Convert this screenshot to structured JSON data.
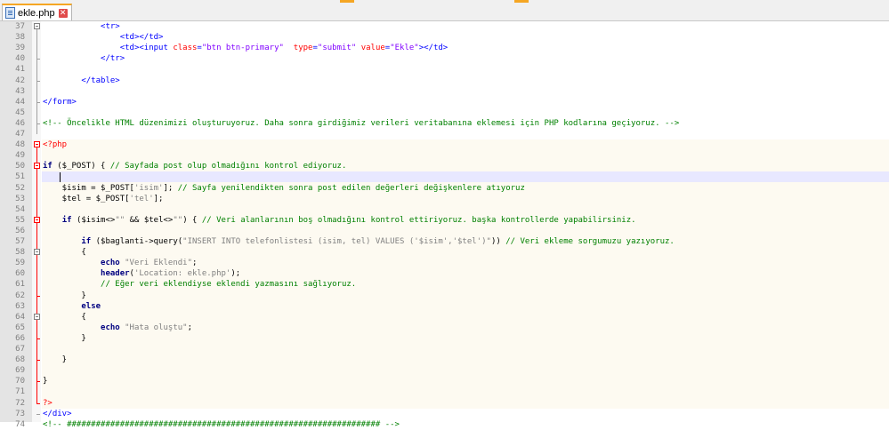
{
  "tab": {
    "label": "ekle.php",
    "close": "✕",
    "file_icon": "php-file-icon"
  },
  "lines": [
    {
      "n": "37",
      "segs": [
        {
          "c": "tg",
          "t": "            <tr>"
        }
      ]
    },
    {
      "n": "38",
      "segs": [
        {
          "c": "tg",
          "t": "                <td></td>"
        }
      ]
    },
    {
      "n": "39",
      "segs": [
        {
          "c": "tg",
          "t": "                <td><input "
        },
        {
          "c": "at",
          "t": "class"
        },
        {
          "c": "tg",
          "t": "="
        },
        {
          "c": "va",
          "t": "\"btn btn-primary\""
        },
        {
          "c": "tg",
          "t": "  "
        },
        {
          "c": "at",
          "t": "type"
        },
        {
          "c": "tg",
          "t": "="
        },
        {
          "c": "va",
          "t": "\"submit\""
        },
        {
          "c": "tg",
          "t": " "
        },
        {
          "c": "at",
          "t": "value"
        },
        {
          "c": "tg",
          "t": "="
        },
        {
          "c": "va",
          "t": "\"Ekle\""
        },
        {
          "c": "tg",
          "t": "></td>"
        }
      ]
    },
    {
      "n": "40",
      "segs": [
        {
          "c": "tg",
          "t": "            </tr>"
        }
      ]
    },
    {
      "n": "41",
      "segs": []
    },
    {
      "n": "42",
      "segs": [
        {
          "c": "tg",
          "t": "        </table>"
        }
      ]
    },
    {
      "n": "43",
      "segs": []
    },
    {
      "n": "44",
      "segs": [
        {
          "c": "tg",
          "t": "</form>"
        }
      ]
    },
    {
      "n": "45",
      "segs": []
    },
    {
      "n": "46",
      "segs": [
        {
          "c": "cm",
          "t": "<!-- Öncelikle HTML düzenimizi oluşturuyoruz. Daha sonra girdiğimiz verileri veritabanına eklemesi için PHP kodlarına geçiyoruz. -->"
        }
      ]
    },
    {
      "n": "47",
      "segs": []
    },
    {
      "n": "48",
      "segs": [
        {
          "c": "ph",
          "t": "<?php"
        }
      ]
    },
    {
      "n": "49",
      "segs": []
    },
    {
      "n": "50",
      "segs": [
        {
          "c": "kw",
          "t": "if"
        },
        {
          "c": "",
          "t": " ($_POST) { "
        },
        {
          "c": "cm",
          "t": "// Sayfada post olup olmadığını kontrol ediyoruz."
        }
      ]
    },
    {
      "n": "51",
      "segs": []
    },
    {
      "n": "52",
      "segs": [
        {
          "c": "",
          "t": "    $isim = $_POST["
        },
        {
          "c": "st",
          "t": "'isim'"
        },
        {
          "c": "",
          "t": "]; "
        },
        {
          "c": "cm",
          "t": "// Sayfa yenilendikten sonra post edilen değerleri değişkenlere atıyoruz"
        }
      ]
    },
    {
      "n": "53",
      "segs": [
        {
          "c": "",
          "t": "    $tel = $_POST["
        },
        {
          "c": "st",
          "t": "'tel'"
        },
        {
          "c": "",
          "t": "];"
        }
      ]
    },
    {
      "n": "54",
      "segs": []
    },
    {
      "n": "55",
      "segs": [
        {
          "c": "",
          "t": "    "
        },
        {
          "c": "kw",
          "t": "if"
        },
        {
          "c": "",
          "t": " ($isim<>"
        },
        {
          "c": "st",
          "t": "\"\""
        },
        {
          "c": "",
          "t": " && $tel<>"
        },
        {
          "c": "st",
          "t": "\"\""
        },
        {
          "c": "",
          "t": ") { "
        },
        {
          "c": "cm",
          "t": "// Veri alanlarının boş olmadığını kontrol ettiriyoruz. başka kontrollerde yapabilirsiniz."
        }
      ]
    },
    {
      "n": "56",
      "segs": []
    },
    {
      "n": "57",
      "segs": [
        {
          "c": "",
          "t": "        "
        },
        {
          "c": "kw",
          "t": "if"
        },
        {
          "c": "",
          "t": " ($baglanti->query("
        },
        {
          "c": "st",
          "t": "\"INSERT INTO telefonlistesi (isim, tel) VALUES ('$isim','$tel')\""
        },
        {
          "c": "",
          "t": ")) "
        },
        {
          "c": "cm",
          "t": "// Veri ekleme sorgumuzu yazıyoruz."
        }
      ]
    },
    {
      "n": "58",
      "segs": [
        {
          "c": "",
          "t": "        {"
        }
      ]
    },
    {
      "n": "59",
      "segs": [
        {
          "c": "",
          "t": "            "
        },
        {
          "c": "kw",
          "t": "echo"
        },
        {
          "c": "",
          "t": " "
        },
        {
          "c": "st",
          "t": "\"Veri Eklendi\""
        },
        {
          "c": "",
          "t": ";"
        }
      ]
    },
    {
      "n": "60",
      "segs": [
        {
          "c": "",
          "t": "            "
        },
        {
          "c": "kw",
          "t": "header"
        },
        {
          "c": "",
          "t": "("
        },
        {
          "c": "st",
          "t": "'Location: ekle.php'"
        },
        {
          "c": "",
          "t": ");"
        }
      ]
    },
    {
      "n": "61",
      "segs": [
        {
          "c": "",
          "t": "            "
        },
        {
          "c": "cm",
          "t": "// Eğer veri eklendiyse eklendi yazmasını sağlıyoruz."
        }
      ]
    },
    {
      "n": "62",
      "segs": [
        {
          "c": "",
          "t": "        }"
        }
      ]
    },
    {
      "n": "63",
      "segs": [
        {
          "c": "",
          "t": "        "
        },
        {
          "c": "kw",
          "t": "else"
        }
      ]
    },
    {
      "n": "64",
      "segs": [
        {
          "c": "",
          "t": "        {"
        }
      ]
    },
    {
      "n": "65",
      "segs": [
        {
          "c": "",
          "t": "            "
        },
        {
          "c": "kw",
          "t": "echo"
        },
        {
          "c": "",
          "t": " "
        },
        {
          "c": "st",
          "t": "\"Hata oluştu\""
        },
        {
          "c": "",
          "t": ";"
        }
      ]
    },
    {
      "n": "66",
      "segs": [
        {
          "c": "",
          "t": "        }"
        }
      ]
    },
    {
      "n": "67",
      "segs": []
    },
    {
      "n": "68",
      "segs": [
        {
          "c": "",
          "t": "    }"
        }
      ]
    },
    {
      "n": "69",
      "segs": []
    },
    {
      "n": "70",
      "segs": [
        {
          "c": "",
          "t": "}"
        }
      ]
    },
    {
      "n": "71",
      "segs": []
    },
    {
      "n": "72",
      "segs": [
        {
          "c": "ph",
          "t": "?>"
        }
      ]
    },
    {
      "n": "73",
      "segs": [
        {
          "c": "tg",
          "t": "</div>"
        }
      ]
    },
    {
      "n": "74",
      "segs": [
        {
          "c": "cm",
          "t": "<!-- ################################################################# -->"
        }
      ]
    }
  ]
}
